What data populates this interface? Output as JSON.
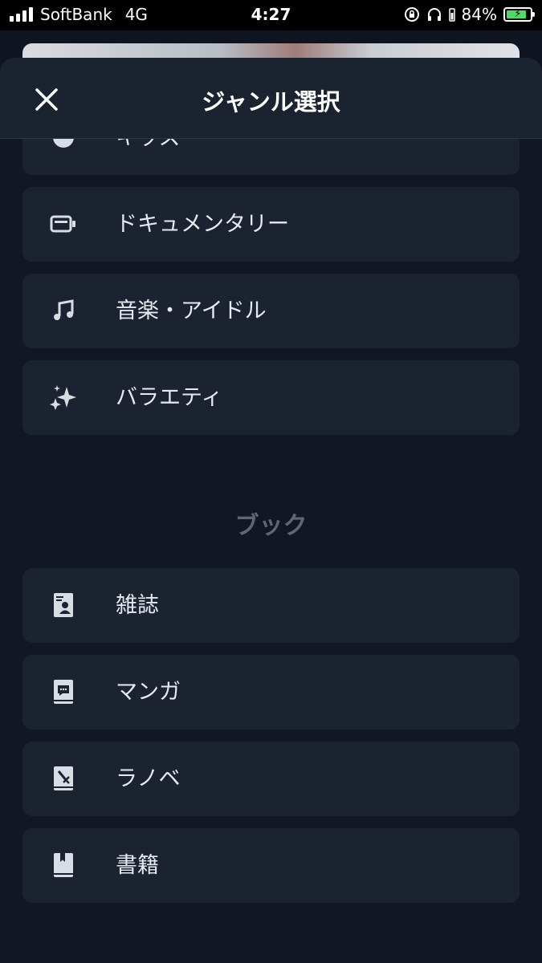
{
  "status_bar": {
    "carrier": "SoftBank",
    "network": "4G",
    "time": "4:27",
    "battery_percent": "84%",
    "battery_level": 0.84,
    "battery_color": "#4cd964"
  },
  "sheet": {
    "title": "ジャンル選択",
    "close_icon": "close-icon"
  },
  "top_items": [
    {
      "label": "キッズ",
      "icon": "kids-icon"
    },
    {
      "label": "ドキュメンタリー",
      "icon": "camera-icon"
    },
    {
      "label": "音楽・アイドル",
      "icon": "music-note-icon"
    },
    {
      "label": "バラエティ",
      "icon": "sparkles-icon"
    }
  ],
  "book_section": {
    "heading": "ブック",
    "items": [
      {
        "label": "雑誌",
        "icon": "magazine-icon"
      },
      {
        "label": "マンガ",
        "icon": "manga-icon"
      },
      {
        "label": "ラノベ",
        "icon": "light-novel-icon"
      },
      {
        "label": "書籍",
        "icon": "book-icon"
      }
    ]
  }
}
